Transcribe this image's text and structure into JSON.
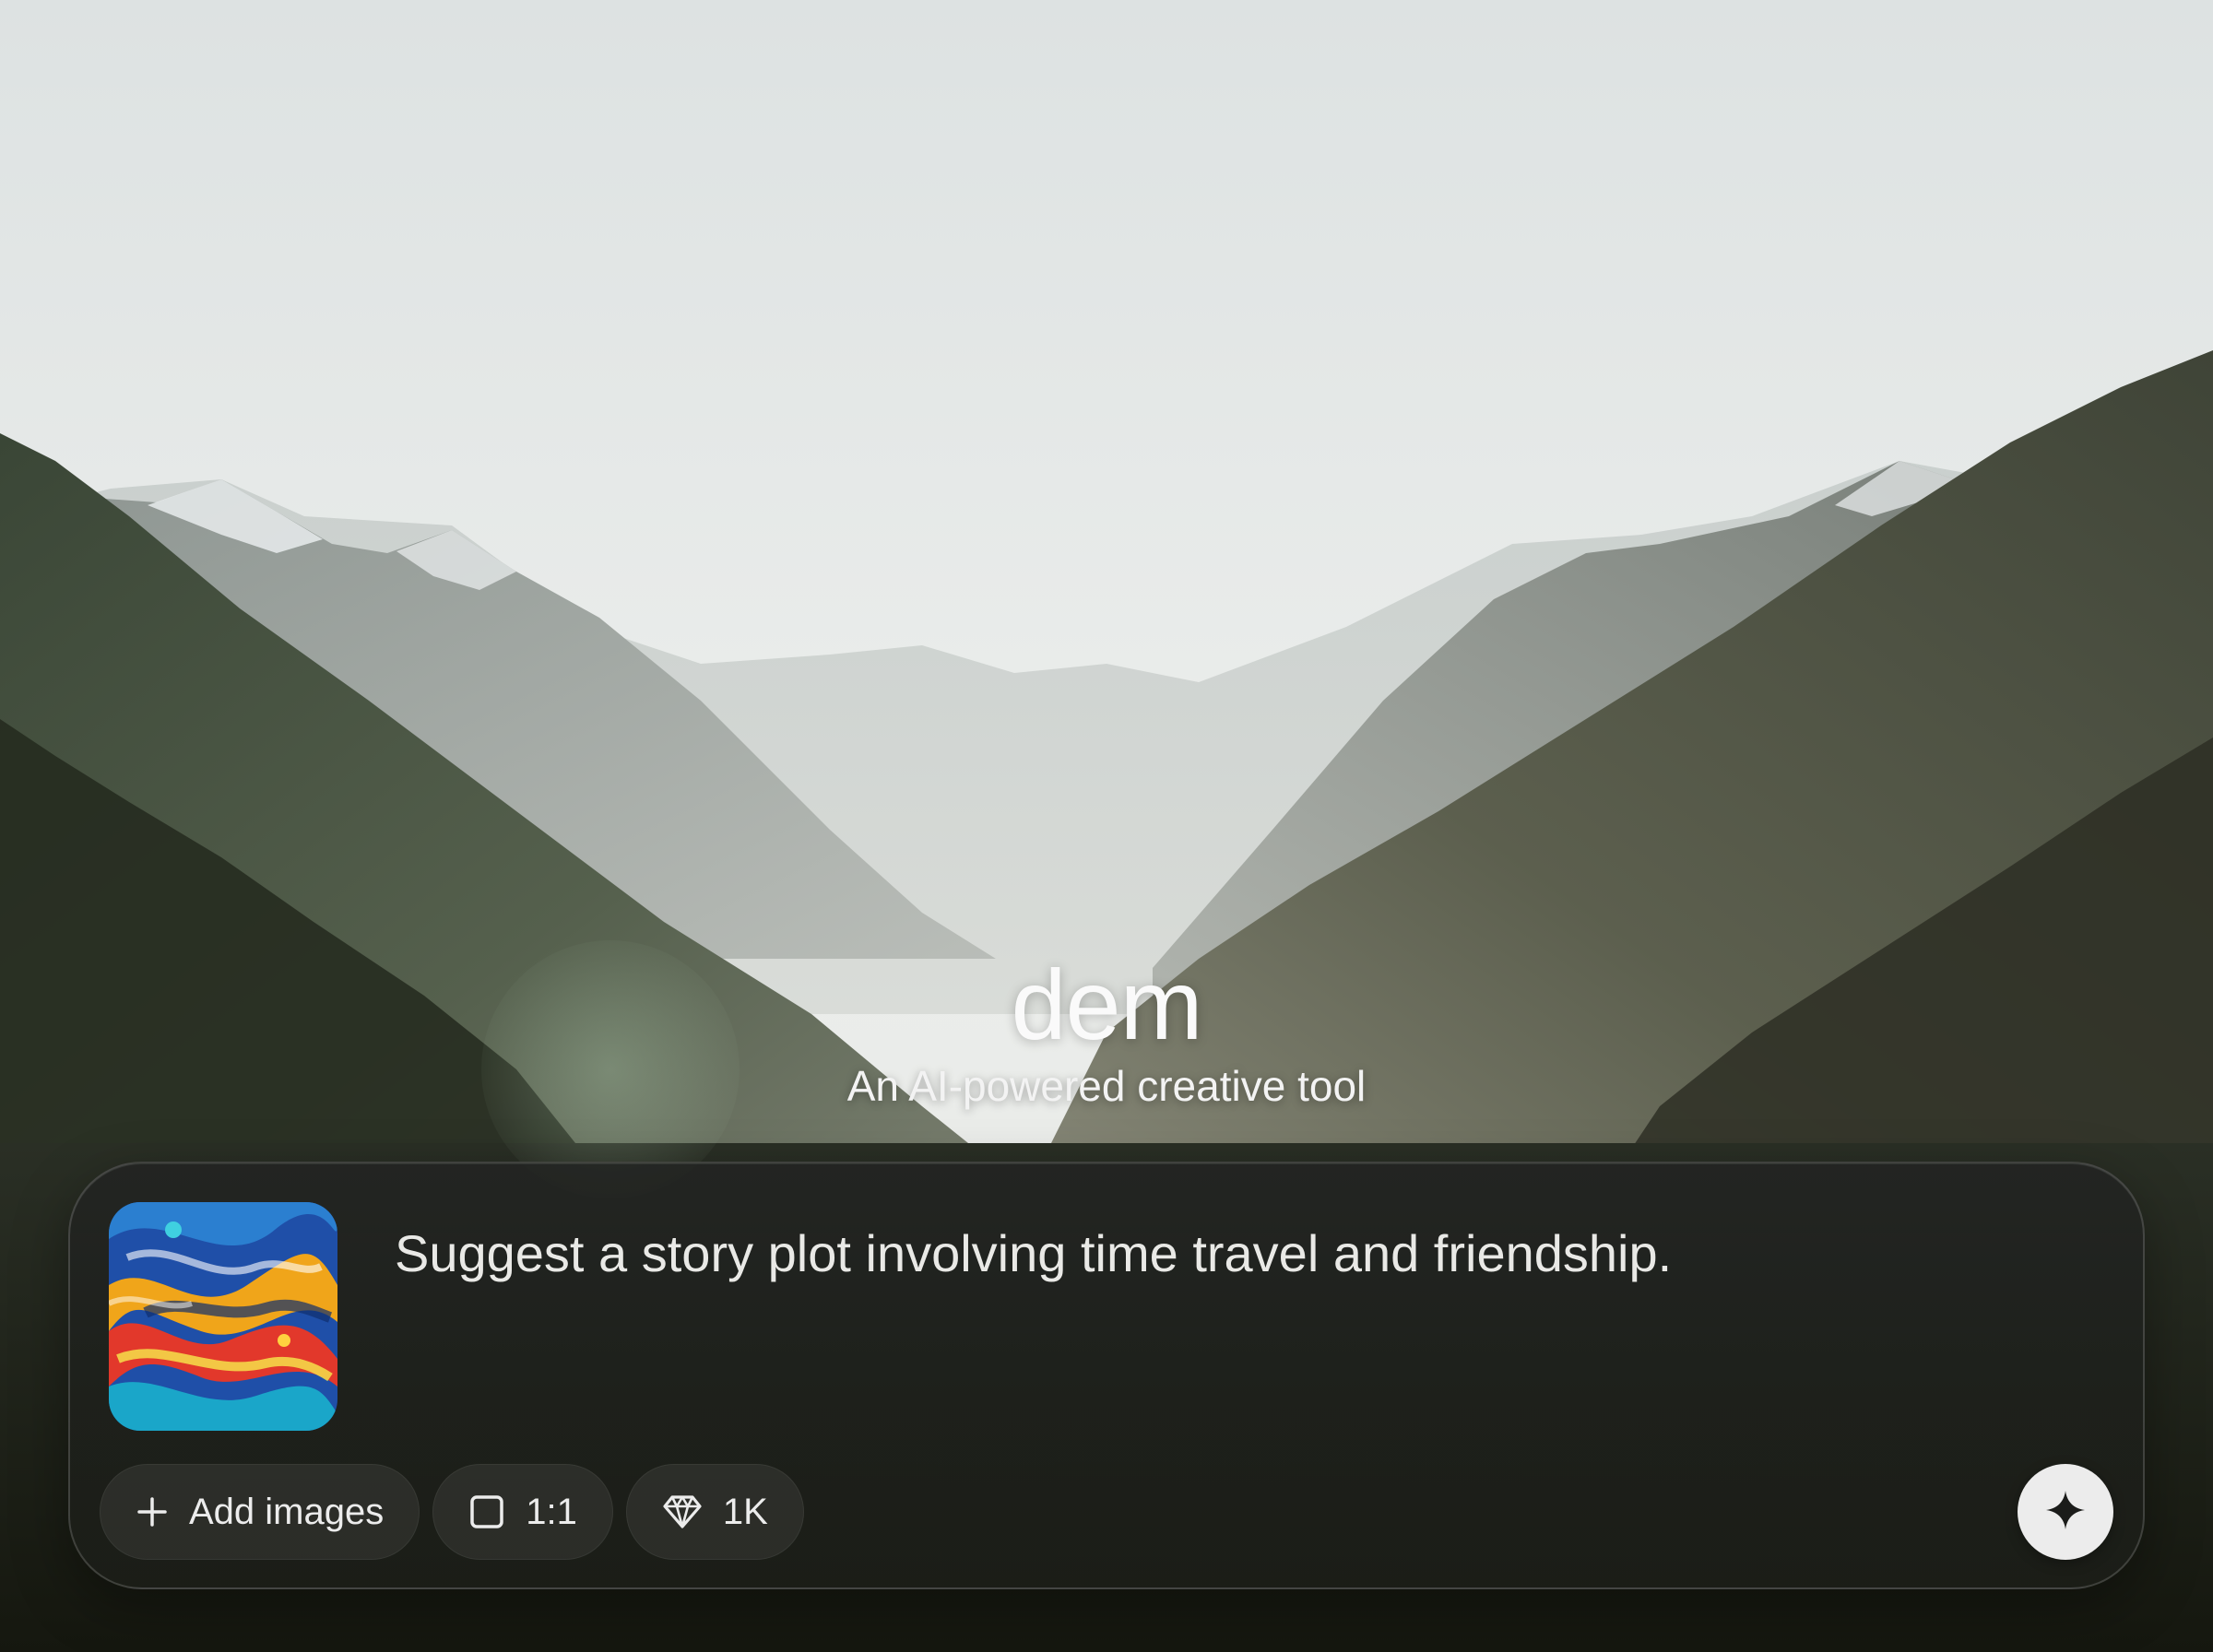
{
  "app": {
    "name": "dem",
    "tagline": "An AI-powered creative tool"
  },
  "prompt": {
    "text": "Suggest a story plot involving time travel and friendship.",
    "attachment_icon": "abstract-swirl-painting"
  },
  "toolbar": {
    "add_images": {
      "label": "Add images",
      "icon": "plus-icon"
    },
    "aspect_ratio": {
      "label": "1:1",
      "icon": "square-icon"
    },
    "resolution": {
      "label": "1K",
      "icon": "diamond-icon"
    }
  },
  "send": {
    "icon": "sparkle-icon"
  },
  "colors": {
    "accent": "#ececec",
    "card_bg": "#222422",
    "text": "#e9e9e6"
  }
}
